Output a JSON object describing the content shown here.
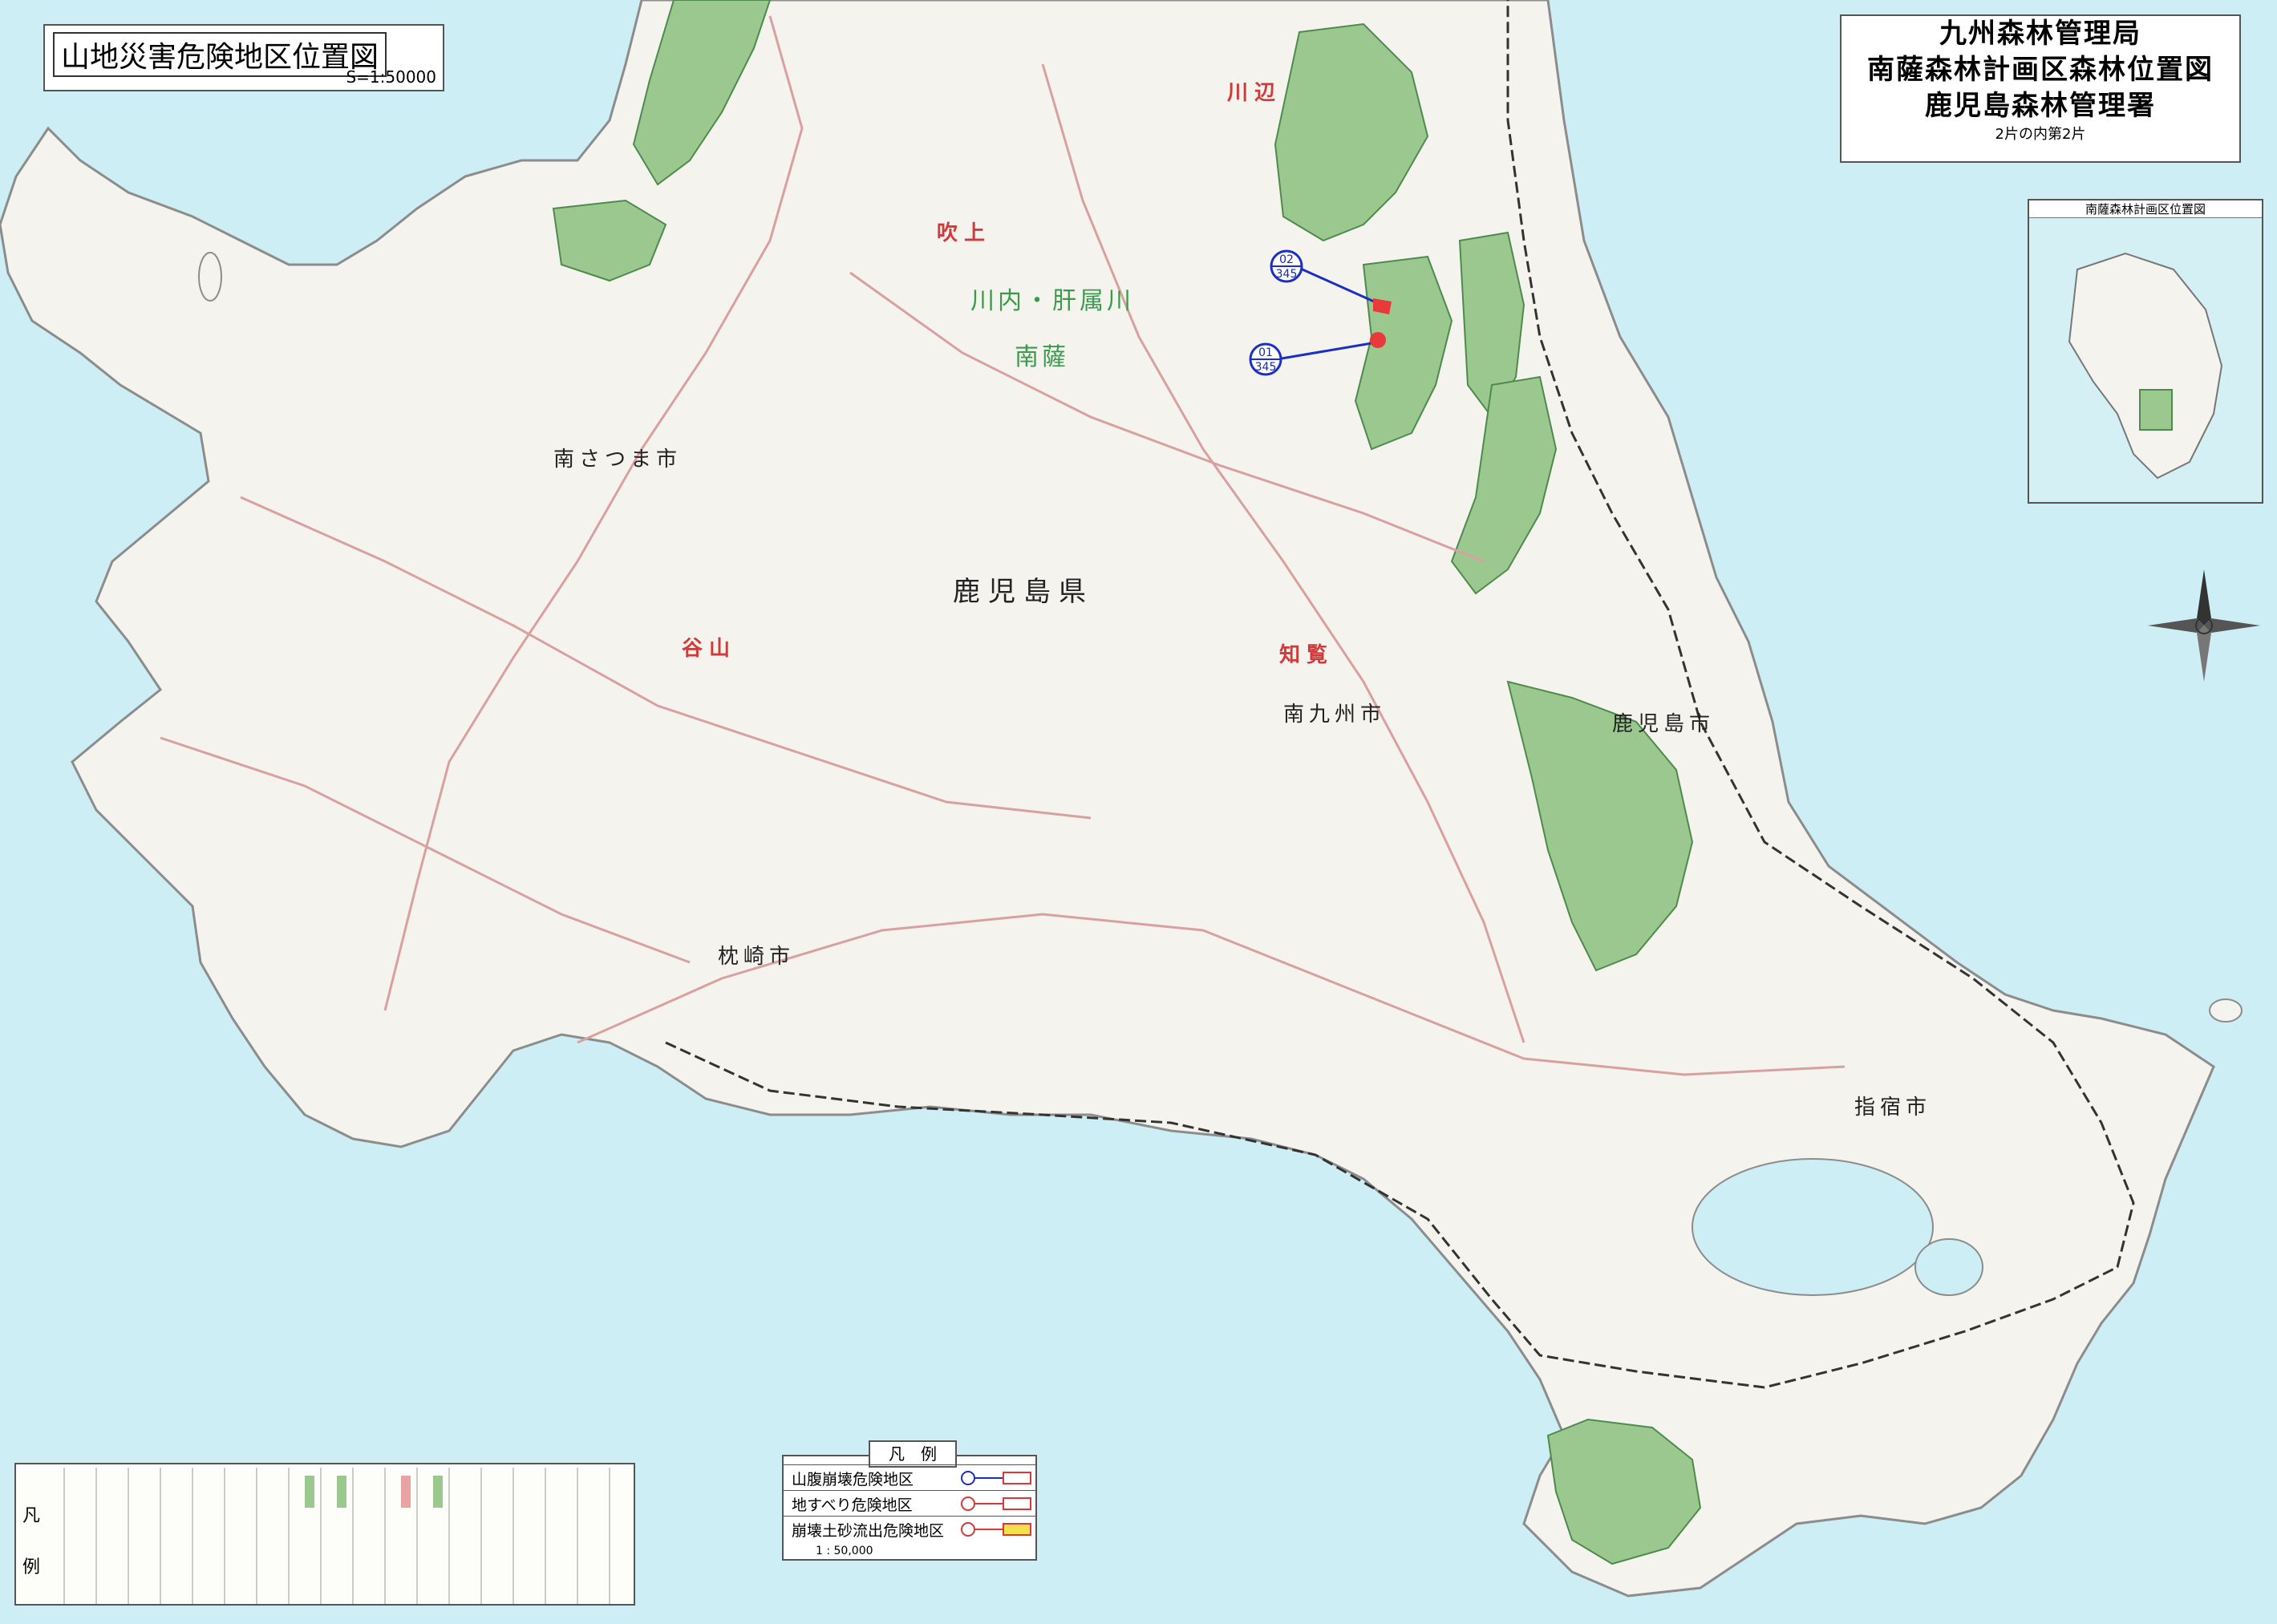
{
  "map_title": {
    "main": "山地災害危険地区位置図",
    "scale": "S=1:50000"
  },
  "office_block": {
    "line1": "九州森林管理局",
    "line2": "南薩森林計画区森林位置図",
    "line3": "鹿児島森林管理署",
    "sheet": "2片の内第2片"
  },
  "inset": {
    "title": "南薩森林計画区位置図"
  },
  "labels": {
    "prefecture": "鹿児島県",
    "cities": [
      {
        "name": "南さつま市"
      },
      {
        "name": "南九州市"
      },
      {
        "name": "鹿児島市"
      },
      {
        "name": "枕崎市"
      },
      {
        "name": "指宿市"
      }
    ],
    "planning_areas": [
      {
        "name": "川内・肝属川"
      },
      {
        "name": "南薩"
      }
    ],
    "districts": [
      {
        "name": "川辺"
      },
      {
        "name": "吹上"
      },
      {
        "name": "谷山"
      },
      {
        "name": "知覧"
      }
    ]
  },
  "hazard_markers": [
    {
      "top": "02",
      "bottom": "345"
    },
    {
      "top": "01",
      "bottom": "345"
    }
  ],
  "hazard_legend": {
    "heading": "凡　例",
    "scale": "1 : 50,000",
    "rows": [
      {
        "label": "山腹崩壊危険地区",
        "color": "#1c2fc4",
        "fill": "#ffffff"
      },
      {
        "label": "地すべり危険地区",
        "color": "#d43a3a",
        "fill": "#ffffff"
      },
      {
        "label": "崩壊土砂流出危険地区",
        "color": "#d43a3a",
        "fill": "#f3e04a"
      }
    ]
  },
  "map_legend": {
    "heading_top": "凡",
    "heading_bottom": "例"
  },
  "colors": {
    "sea": "#cdeef4",
    "land": "#f4f3ee",
    "forest": "#9bc88f",
    "road": "#d9a0a0",
    "rail": "#333333"
  },
  "icons": [
    "compass-rose-icon"
  ]
}
